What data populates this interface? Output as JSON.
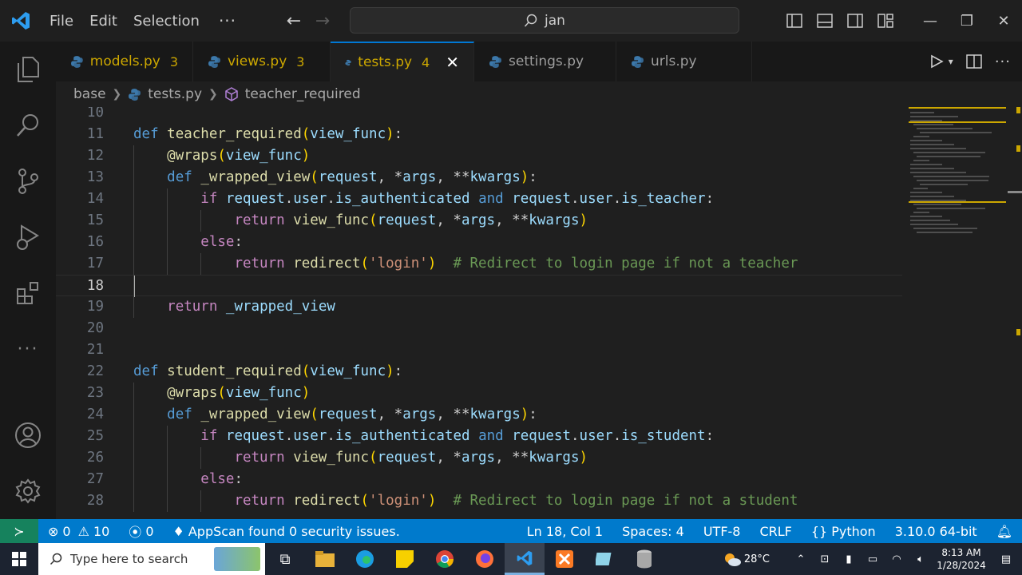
{
  "menu": {
    "file": "File",
    "edit": "Edit",
    "selection": "Selection",
    "more": "···"
  },
  "search": {
    "text": "jan"
  },
  "tabs": [
    {
      "name": "models.py",
      "count": "3",
      "warn": true
    },
    {
      "name": "views.py",
      "count": "3",
      "warn": true
    },
    {
      "name": "tests.py",
      "count": "4",
      "warn": true,
      "active": true
    },
    {
      "name": "settings.py",
      "count": "",
      "warn": false
    },
    {
      "name": "urls.py",
      "count": "",
      "warn": false
    }
  ],
  "breadcrumb": {
    "folder": "base",
    "file": "tests.py",
    "symbol": "teacher_required"
  },
  "editor": {
    "current_line": 18,
    "lines": [
      {
        "n": "10",
        "html": ""
      },
      {
        "n": "11",
        "html": "<span class=\"k\">def</span> <span class=\"f\">teacher_required</span><span class=\"br\">(</span><span class=\"v\">view_func</span><span class=\"br\">)</span>:"
      },
      {
        "n": "12",
        "html": "    <span class=\"d\">@wraps</span><span class=\"br\">(</span><span class=\"v\">view_func</span><span class=\"br\">)</span>"
      },
      {
        "n": "13",
        "html": "    <span class=\"k\">def</span> <span class=\"f\">_wrapped_view</span><span class=\"br\">(</span><span class=\"v\">request</span>, *<span class=\"v\">args</span>, **<span class=\"v\">kwargs</span><span class=\"br\">)</span>:"
      },
      {
        "n": "14",
        "html": "        <span class=\"kw\">if</span> <span class=\"v\">request</span>.<span class=\"v\">user</span>.<span class=\"v\">is_authenticated</span> <span class=\"k\">and</span> <span class=\"v\">request</span>.<span class=\"v\">user</span>.<span class=\"v\">is_teacher</span>:"
      },
      {
        "n": "15",
        "html": "            <span class=\"kw\">return</span> <span class=\"f\">view_func</span><span class=\"br\">(</span><span class=\"v\">request</span>, *<span class=\"v\">args</span>, **<span class=\"v\">kwargs</span><span class=\"br\">)</span>"
      },
      {
        "n": "16",
        "html": "        <span class=\"kw\">else</span>:"
      },
      {
        "n": "17",
        "html": "            <span class=\"kw\">return</span> <span class=\"f\">redirect</span><span class=\"br\">(</span><span class=\"s\">'login'</span><span class=\"br\">)</span>  <span class=\"c\"># Redirect to login page if not a teacher</span>"
      },
      {
        "n": "18",
        "html": ""
      },
      {
        "n": "19",
        "html": "    <span class=\"kw\">return</span> <span class=\"v\">_wrapped_view</span>"
      },
      {
        "n": "20",
        "html": ""
      },
      {
        "n": "21",
        "html": ""
      },
      {
        "n": "22",
        "html": "<span class=\"k\">def</span> <span class=\"f\">student_required</span><span class=\"br\">(</span><span class=\"v\">view_func</span><span class=\"br\">)</span>:"
      },
      {
        "n": "23",
        "html": "    <span class=\"d\">@wraps</span><span class=\"br\">(</span><span class=\"v\">view_func</span><span class=\"br\">)</span>"
      },
      {
        "n": "24",
        "html": "    <span class=\"k\">def</span> <span class=\"f\">_wrapped_view</span><span class=\"br\">(</span><span class=\"v\">request</span>, *<span class=\"v\">args</span>, **<span class=\"v\">kwargs</span><span class=\"br\">)</span>:"
      },
      {
        "n": "25",
        "html": "        <span class=\"kw\">if</span> <span class=\"v\">request</span>.<span class=\"v\">user</span>.<span class=\"v\">is_authenticated</span> <span class=\"k\">and</span> <span class=\"v\">request</span>.<span class=\"v\">user</span>.<span class=\"v\">is_student</span>:"
      },
      {
        "n": "26",
        "html": "            <span class=\"kw\">return</span> <span class=\"f\">view_func</span><span class=\"br\">(</span><span class=\"v\">request</span>, *<span class=\"v\">args</span>, **<span class=\"v\">kwargs</span><span class=\"br\">)</span>"
      },
      {
        "n": "27",
        "html": "        <span class=\"kw\">else</span>:"
      },
      {
        "n": "28",
        "html": "            <span class=\"kw\">return</span> <span class=\"f\">redirect</span><span class=\"br\">(</span><span class=\"s\">'login'</span><span class=\"br\">)</span>  <span class=\"c\"># Redirect to login page if not a student</span>"
      }
    ]
  },
  "status": {
    "errors": "0",
    "warnings": "10",
    "ports": "0",
    "appscan": "AppScan found 0 security issues.",
    "position": "Ln 18, Col 1",
    "spaces": "Spaces: 4",
    "encoding": "UTF-8",
    "eol": "CRLF",
    "language": "Python",
    "interpreter": "3.10.0 64-bit"
  },
  "taskbar": {
    "search_placeholder": "Type here to search",
    "temperature": "28°C",
    "time": "8:13 AM",
    "date": "1/28/2024"
  },
  "colors": {
    "accent": "#007acc",
    "remote": "#16825d",
    "warning": "#cca700"
  }
}
